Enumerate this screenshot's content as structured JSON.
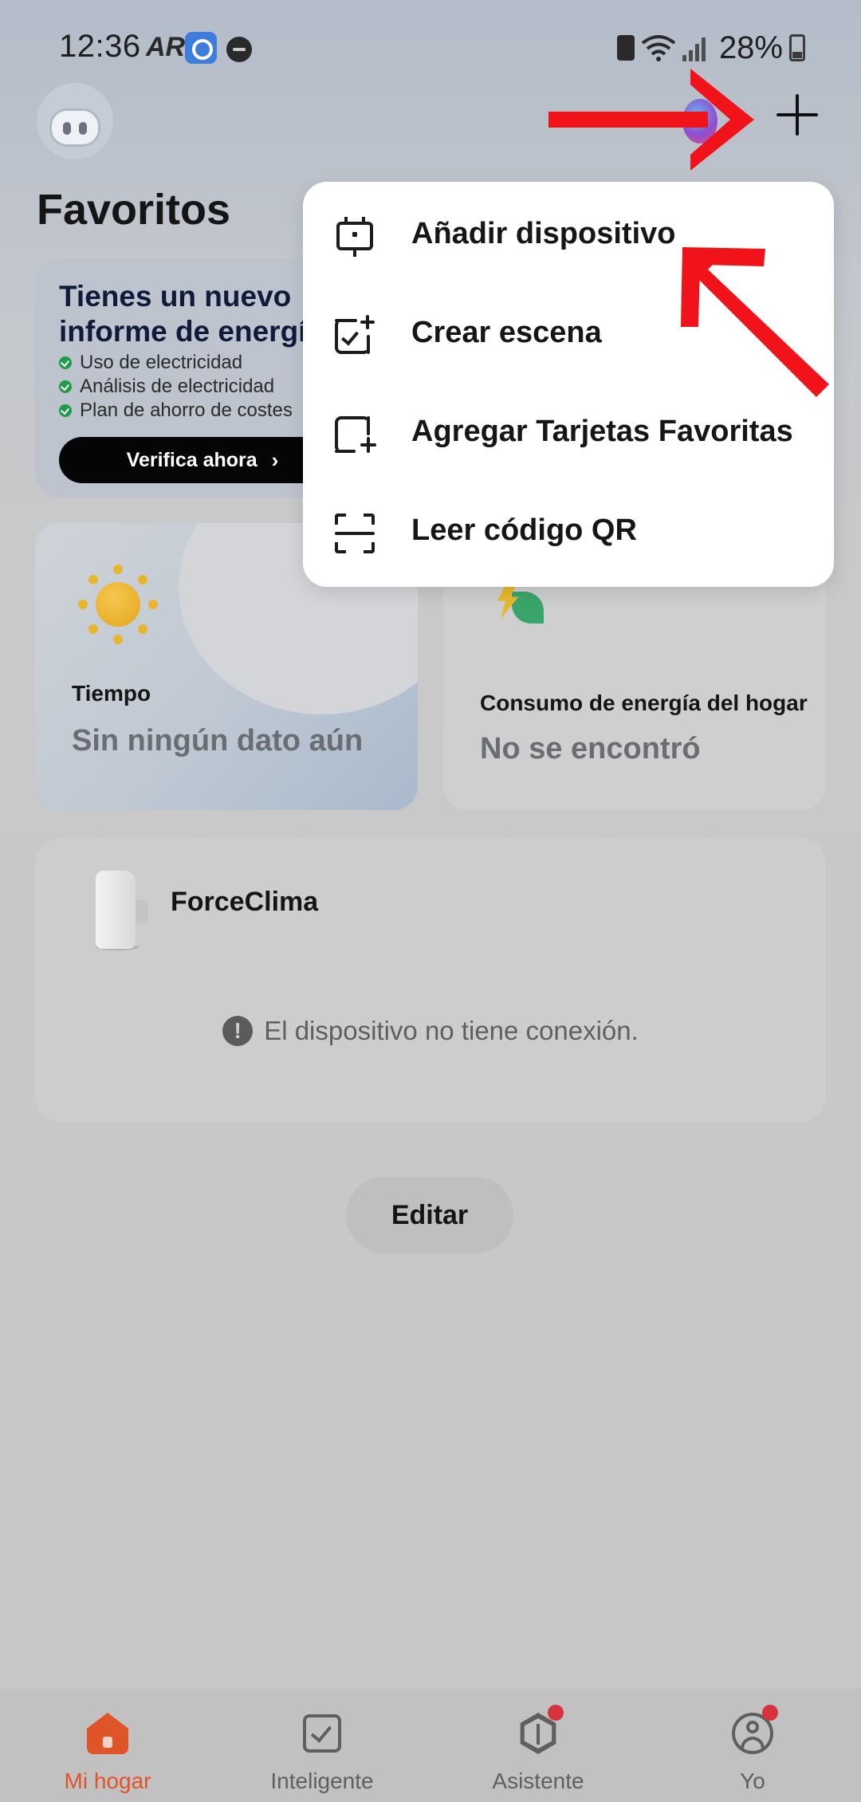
{
  "status_bar": {
    "time": "12:36",
    "ar_label": "AR",
    "battery_percent": "28%"
  },
  "header": {
    "title": "Favoritos"
  },
  "menu": {
    "items": [
      {
        "label": "Añadir dispositivo",
        "icon": "device-icon"
      },
      {
        "label": "Crear escena",
        "icon": "scene-check-icon"
      },
      {
        "label": "Agregar Tarjetas Favoritas",
        "icon": "add-card-icon"
      },
      {
        "label": "Leer código QR",
        "icon": "qr-scan-icon"
      }
    ]
  },
  "banner": {
    "title": "Tienes un nuevo informe de energía:",
    "items": [
      "Uso de electricidad",
      "Análisis de electricidad",
      "Plan de ahorro de costes"
    ],
    "button_label": "Verifica ahora"
  },
  "weather_card": {
    "label": "Tiempo",
    "value": "Sin ningún dato aún"
  },
  "energy_card": {
    "label": "Consumo de energía del hogar",
    "value": "No se encontró"
  },
  "device_card": {
    "name": "ForceClima",
    "status": "El dispositivo no tiene conexión."
  },
  "edit_button": {
    "label": "Editar"
  },
  "bottom_nav": {
    "items": [
      {
        "label": "Mi hogar",
        "active": true
      },
      {
        "label": "Inteligente",
        "active": false
      },
      {
        "label": "Asistente",
        "active": false,
        "badge": true
      },
      {
        "label": "Yo",
        "active": false,
        "badge": true
      }
    ]
  },
  "colors": {
    "accent": "#e0542a",
    "annotation": "#f0141a",
    "badge": "#d8323c"
  }
}
